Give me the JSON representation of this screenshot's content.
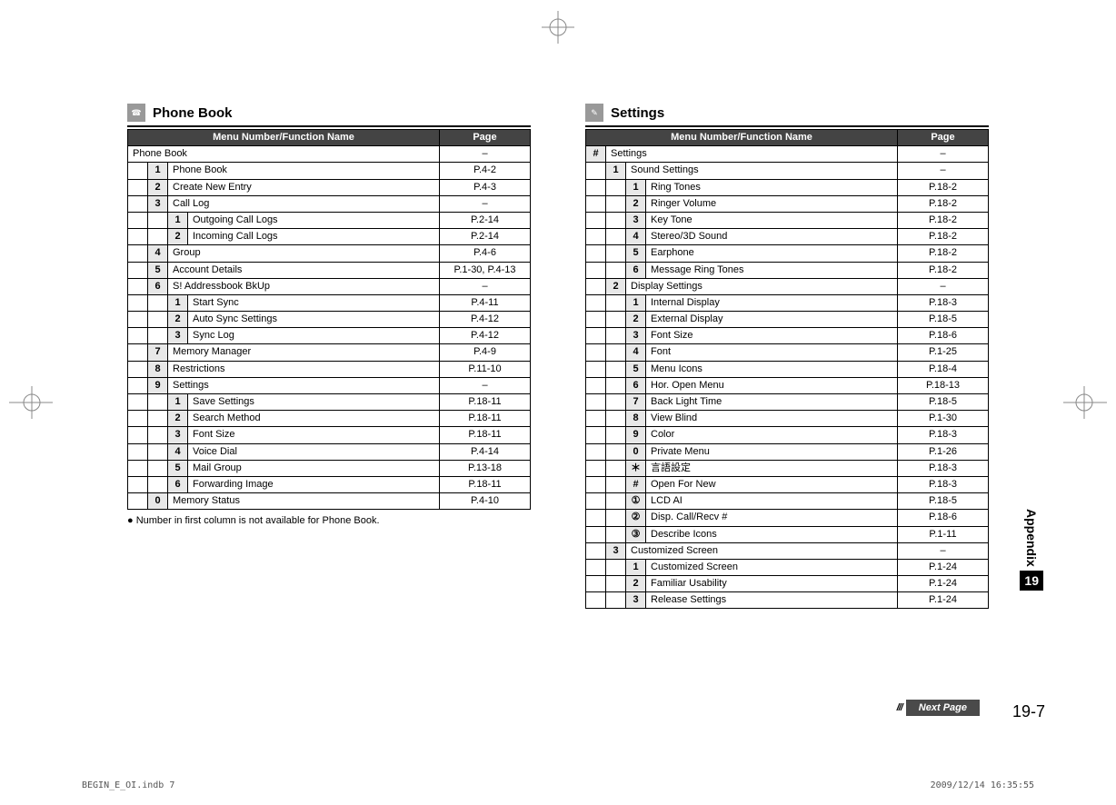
{
  "left": {
    "title": "Phone Book",
    "header_menu": "Menu Number/Function Name",
    "header_page": "Page",
    "root_label": "Phone Book",
    "root_page": "–",
    "rows": [
      {
        "n1": "1",
        "label": "Phone Book",
        "page": "P.4-2"
      },
      {
        "n1": "2",
        "label": "Create New Entry",
        "page": "P.4-3"
      },
      {
        "n1": "3",
        "label": "Call Log",
        "page": "–"
      },
      {
        "n2": "1",
        "label": "Outgoing Call Logs",
        "page": "P.2-14"
      },
      {
        "n2": "2",
        "label": "Incoming Call Logs",
        "page": "P.2-14"
      },
      {
        "n1": "4",
        "label": "Group",
        "page": "P.4-6"
      },
      {
        "n1": "5",
        "label": "Account Details",
        "page": "P.1-30, P.4-13"
      },
      {
        "n1": "6",
        "label": "S! Addressbook BkUp",
        "page": "–"
      },
      {
        "n2": "1",
        "label": "Start Sync",
        "page": "P.4-11"
      },
      {
        "n2": "2",
        "label": "Auto Sync Settings",
        "page": "P.4-12"
      },
      {
        "n2": "3",
        "label": "Sync Log",
        "page": "P.4-12"
      },
      {
        "n1": "7",
        "label": "Memory Manager",
        "page": "P.4-9"
      },
      {
        "n1": "8",
        "label": "Restrictions",
        "page": "P.11-10"
      },
      {
        "n1": "9",
        "label": "Settings",
        "page": "–"
      },
      {
        "n2": "1",
        "label": "Save Settings",
        "page": "P.18-11"
      },
      {
        "n2": "2",
        "label": "Search Method",
        "page": "P.18-11"
      },
      {
        "n2": "3",
        "label": "Font Size",
        "page": "P.18-11"
      },
      {
        "n2": "4",
        "label": "Voice Dial",
        "page": "P.4-14"
      },
      {
        "n2": "5",
        "label": "Mail Group",
        "page": "P.13-18"
      },
      {
        "n2": "6",
        "label": "Forwarding Image",
        "page": "P.18-11"
      },
      {
        "n1": "0",
        "label": "Memory Status",
        "page": "P.4-10"
      }
    ],
    "note": "● Number in first column is not available for Phone Book."
  },
  "right": {
    "title": "Settings",
    "header_menu": "Menu Number/Function Name",
    "header_page": "Page",
    "root_sym": "#",
    "root_label": "Settings",
    "root_page": "–",
    "rows": [
      {
        "n1": "1",
        "label": "Sound Settings",
        "page": "–"
      },
      {
        "n2": "1",
        "label": "Ring Tones",
        "page": "P.18-2"
      },
      {
        "n2": "2",
        "label": "Ringer Volume",
        "page": "P.18-2"
      },
      {
        "n2": "3",
        "label": "Key Tone",
        "page": "P.18-2"
      },
      {
        "n2": "4",
        "label": "Stereo/3D Sound",
        "page": "P.18-2"
      },
      {
        "n2": "5",
        "label": "Earphone",
        "page": "P.18-2"
      },
      {
        "n2": "6",
        "label": "Message Ring Tones",
        "page": "P.18-2"
      },
      {
        "n1": "2",
        "label": "Display Settings",
        "page": "–"
      },
      {
        "n2": "1",
        "label": "Internal Display",
        "page": "P.18-3"
      },
      {
        "n2": "2",
        "label": "External Display",
        "page": "P.18-5"
      },
      {
        "n2": "3",
        "label": "Font Size",
        "page": "P.18-6"
      },
      {
        "n2": "4",
        "label": "Font",
        "page": "P.1-25"
      },
      {
        "n2": "5",
        "label": "Menu Icons",
        "page": "P.18-4"
      },
      {
        "n2": "6",
        "label": "Hor. Open Menu",
        "page": "P.18-13"
      },
      {
        "n2": "7",
        "label": "Back Light Time",
        "page": "P.18-5"
      },
      {
        "n2": "8",
        "label": "View Blind",
        "page": "P.1-30"
      },
      {
        "n2": "9",
        "label": "Color",
        "page": "P.18-3"
      },
      {
        "n2": "0",
        "label": "Private Menu",
        "page": "P.1-26"
      },
      {
        "n2": "＊",
        "label": "言語設定",
        "page": "P.18-3"
      },
      {
        "n2": "#",
        "label": "Open For New",
        "page": "P.18-3"
      },
      {
        "n2": "①",
        "label": "LCD AI",
        "page": "P.18-5"
      },
      {
        "n2": "②",
        "label": "Disp. Call/Recv #",
        "page": "P.18-6"
      },
      {
        "n2": "③",
        "label": "Describe Icons",
        "page": "P.1-11"
      },
      {
        "n1": "3",
        "label": "Customized Screen",
        "page": "–"
      },
      {
        "n2": "1",
        "label": "Customized Screen",
        "page": "P.1-24"
      },
      {
        "n2": "2",
        "label": "Familiar Usability",
        "page": "P.1-24"
      },
      {
        "n2": "3",
        "label": "Release Settings",
        "page": "P.1-24"
      }
    ]
  },
  "side_tab": {
    "label": "Appendix",
    "num": "19"
  },
  "next_page": "Next Page",
  "page_number": "19-7",
  "footer": {
    "left": "BEGIN_E_OI.indb   7",
    "right": "2009/12/14   16:35:55"
  }
}
